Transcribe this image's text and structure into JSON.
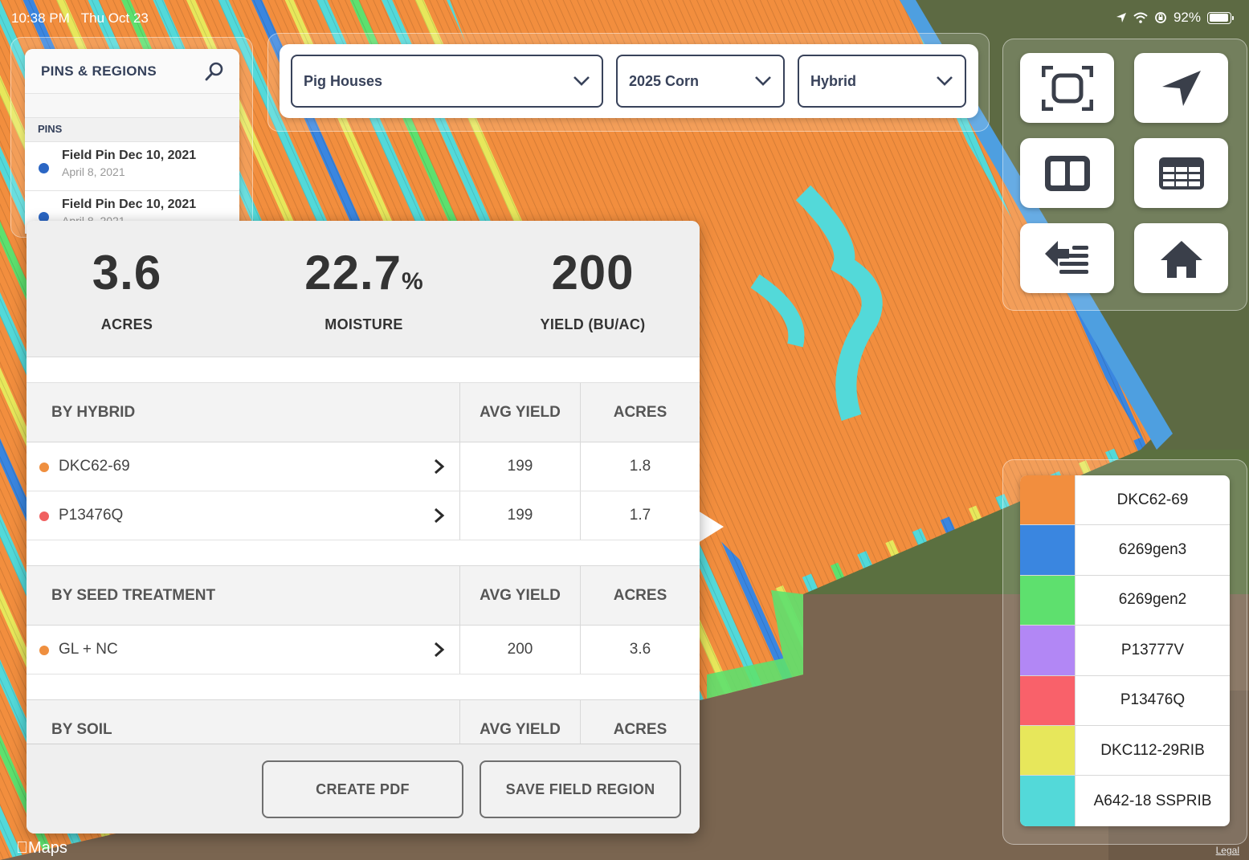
{
  "status_bar": {
    "time": "10:38 PM",
    "date": "Thu Oct 23",
    "battery": "92%"
  },
  "pins_panel": {
    "title": "PINS & REGIONS",
    "section": "PINS",
    "items": [
      {
        "title": "Field Pin Dec 10, 2021",
        "date": "April 8, 2021"
      },
      {
        "title": "Field Pin Dec 10, 2021",
        "date": "April 8, 2021"
      }
    ]
  },
  "filters": {
    "field": "Pig Houses",
    "season": "2025 Corn",
    "layer": "Hybrid"
  },
  "tools": [
    "fit-extent-icon",
    "locate-arrow-icon",
    "split-view-icon",
    "table-icon",
    "list-back-icon",
    "home-icon"
  ],
  "summary": {
    "acres": {
      "value": "3.6",
      "label": "ACRES"
    },
    "moisture": {
      "value": "22.7",
      "unit": "%",
      "label": "MOISTURE"
    },
    "yield": {
      "value": "200",
      "label": "YIELD (BU/AC)"
    }
  },
  "tables": [
    {
      "header": "BY HYBRID",
      "col2": "AVG YIELD",
      "col3": "ACRES",
      "rows": [
        {
          "name": "DKC62-69",
          "avg_yield": "199",
          "acres": "1.8",
          "color": "#ef8f3f"
        },
        {
          "name": "P13476Q",
          "avg_yield": "199",
          "acres": "1.7",
          "color": "#f06060"
        }
      ]
    },
    {
      "header": "BY SEED TREATMENT",
      "col2": "AVG YIELD",
      "col3": "ACRES",
      "rows": [
        {
          "name": "GL + NC",
          "avg_yield": "200",
          "acres": "3.6",
          "color": "#ef8f3f"
        }
      ]
    },
    {
      "header": "BY SOIL",
      "col2": "AVG YIELD",
      "col3": "ACRES",
      "rows": []
    }
  ],
  "actions": {
    "create_pdf": "CREATE PDF",
    "save_region": "SAVE FIELD REGION"
  },
  "legend": [
    {
      "label": "DKC62-69",
      "color": "#f28e3e"
    },
    {
      "label": "6269gen3",
      "color": "#3a86e0"
    },
    {
      "label": "6269gen2",
      "color": "#5ee06e"
    },
    {
      "label": "P13777V",
      "color": "#b287f5"
    },
    {
      "label": "P13476Q",
      "color": "#f9616a"
    },
    {
      "label": "DKC112-29RIB",
      "color": "#e7e75b"
    },
    {
      "label": "A642-18 SSPRIB",
      "color": "#53d9d9"
    }
  ],
  "footer": {
    "maps": "Maps",
    "legal": "Legal"
  }
}
